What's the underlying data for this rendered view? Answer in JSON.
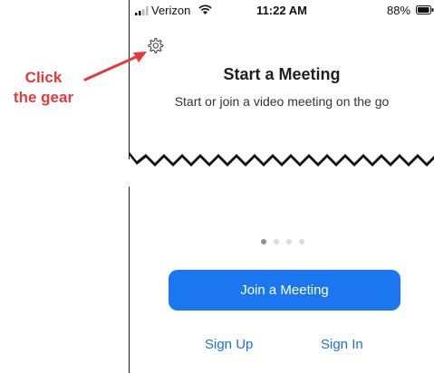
{
  "status_bar": {
    "carrier": "Verizon",
    "time": "11:22 AM",
    "battery": "88%"
  },
  "main": {
    "title": "Start a Meeting",
    "subtitle": "Start or join a video meeting on the go"
  },
  "annotation": {
    "text_line1": "Click",
    "text_line2": "the gear",
    "color": "#e53939"
  },
  "pager": {
    "total": 4,
    "active": 1
  },
  "actions": {
    "join_label": "Join a Meeting",
    "sign_up_label": "Sign Up",
    "sign_in_label": "Sign In"
  },
  "colors": {
    "accent": "#1b76f0",
    "link": "#1b6fe8"
  },
  "icons": [
    "signal-icon",
    "wifi-icon",
    "battery-icon",
    "gear-icon",
    "arrow-icon"
  ]
}
